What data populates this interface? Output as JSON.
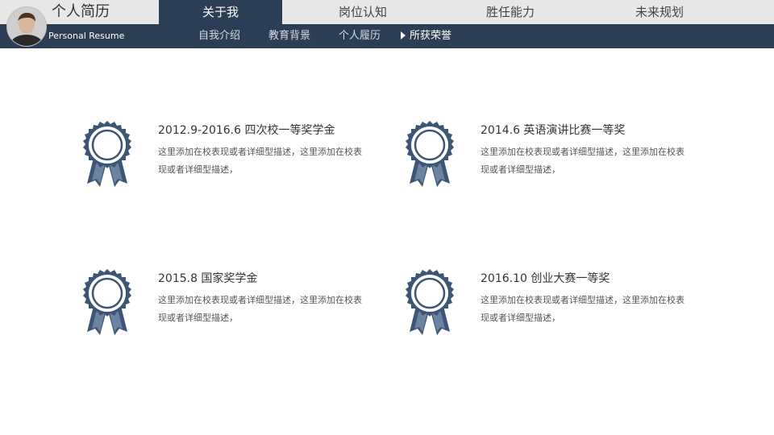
{
  "header": {
    "title": "个人简历",
    "subtitle": "Personal Resume",
    "tabs": [
      {
        "label": "关于我"
      },
      {
        "label": "岗位认知"
      },
      {
        "label": "胜任能力"
      },
      {
        "label": "未来规划"
      }
    ],
    "subnav": [
      {
        "label": "自我介绍"
      },
      {
        "label": "教育背景"
      },
      {
        "label": "个人履历"
      },
      {
        "label": "所获荣誉"
      }
    ]
  },
  "awards": [
    {
      "title": "2012.9-2016.6 四次校一等奖学金",
      "desc": "这里添加在校表现或者详细型描述，这里添加在校表现或者详细型描述，"
    },
    {
      "title": "2014.6 英语演讲比赛一等奖",
      "desc": "这里添加在校表现或者详细型描述，这里添加在校表现或者详细型描述，"
    },
    {
      "title": "2015.8 国家奖学金",
      "desc": "这里添加在校表现或者详细型描述，这里添加在校表现或者详细型描述，"
    },
    {
      "title": "2016.10 创业大赛一等奖",
      "desc": "这里添加在校表现或者详细型描述，这里添加在校表现或者详细型描述，"
    }
  ],
  "colors": {
    "navy": "#2c3e55",
    "bar": "#e8e8e8",
    "badge": "#3d5675"
  }
}
